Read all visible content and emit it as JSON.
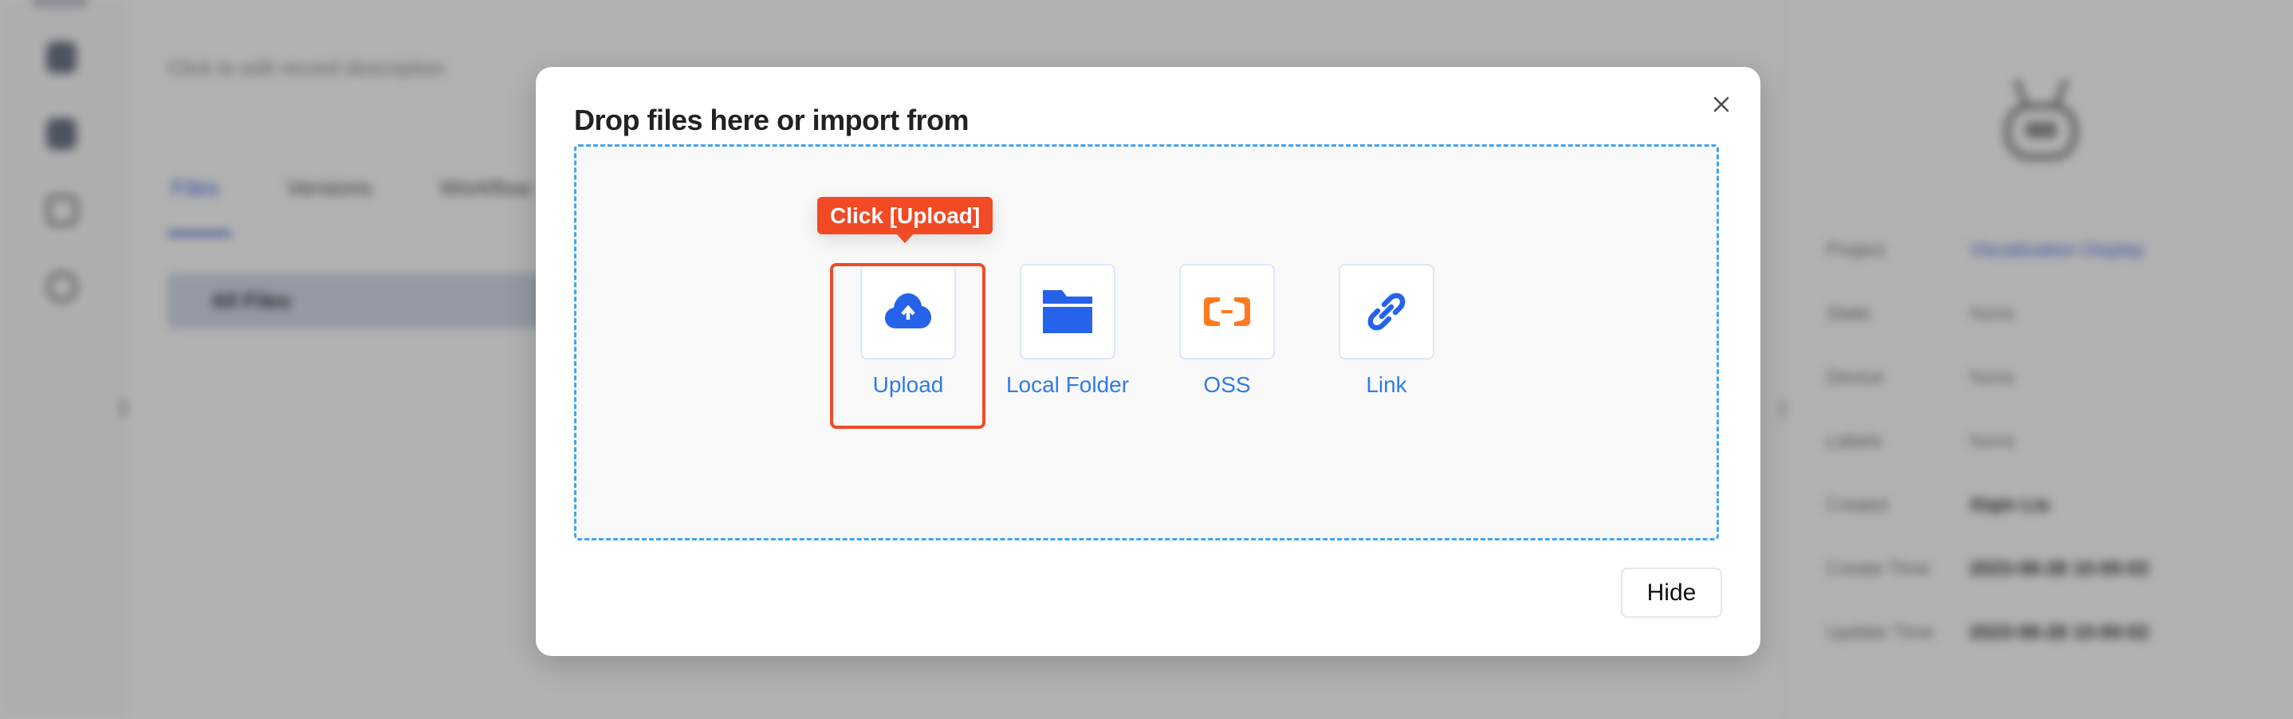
{
  "background": {
    "description_placeholder": "Click to edit record description",
    "tabs": [
      {
        "label": "Files",
        "active": true
      },
      {
        "label": "Versions",
        "active": false
      },
      {
        "label": "Workflow",
        "active": false
      }
    ],
    "files_filter": "All Files",
    "meta": [
      {
        "label": "Project",
        "value": "Visualization Display",
        "style": "link"
      },
      {
        "label": "State",
        "value": "None",
        "style": "muted"
      },
      {
        "label": "Device",
        "value": "None",
        "style": "muted"
      },
      {
        "label": "Labels",
        "value": "None",
        "style": "muted"
      },
      {
        "label": "Creator",
        "value": "Xiqin Liu",
        "style": "strong"
      },
      {
        "label": "Create Time",
        "value": "2023-08-28 10:00:02",
        "style": "strong"
      },
      {
        "label": "Update Time",
        "value": "2023-08-28 10:00:02",
        "style": "strong"
      }
    ]
  },
  "modal": {
    "title": "Drop files here or import from",
    "close_icon": "close-icon",
    "sources": [
      {
        "label": "Upload",
        "icon": "cloud-upload-icon"
      },
      {
        "label": "Local Folder",
        "icon": "folder-icon"
      },
      {
        "label": "OSS",
        "icon": "oss-icon"
      },
      {
        "label": "Link",
        "icon": "link-icon"
      }
    ],
    "hide_label": "Hide"
  },
  "annotation": {
    "tooltip": "Click [Upload]",
    "target": "Upload"
  },
  "colors": {
    "accent_blue": "#2563eb",
    "label_blue": "#2f7bea",
    "dashed_border": "#3ea5f5",
    "highlight_red": "#ef4b27",
    "oss_orange": "#ff7a1f"
  }
}
